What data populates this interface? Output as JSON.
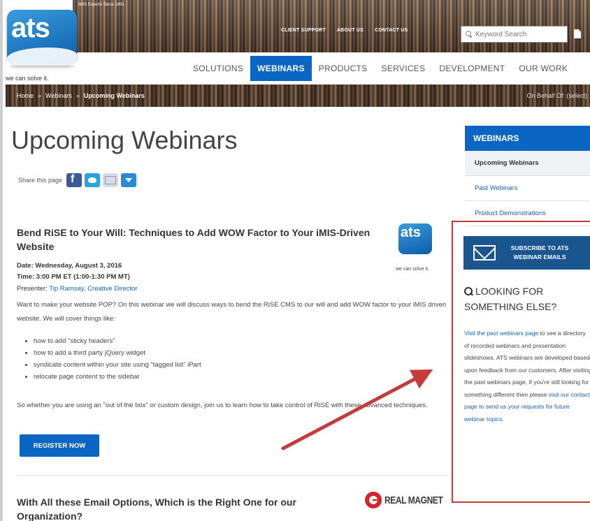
{
  "header": {
    "tagline_top": "iMIS Experts Since 1991",
    "logo_text": "ats",
    "logo_caption": "we can solve it.",
    "top_links": [
      "CLIENT SUPPORT",
      "ABOUT US",
      "CONTACT US"
    ],
    "search_placeholder": "Keyword Search"
  },
  "nav": {
    "items": [
      {
        "label": "SOLUTIONS",
        "active": false
      },
      {
        "label": "WEBINARS",
        "active": true
      },
      {
        "label": "PRODUCTS",
        "active": false
      },
      {
        "label": "SERVICES",
        "active": false
      },
      {
        "label": "DEVELOPMENT",
        "active": false
      },
      {
        "label": "OUR WORK",
        "active": false
      }
    ]
  },
  "breadcrumb": {
    "home": "Home",
    "section": "Webinars",
    "current": "Upcoming Webinars",
    "sep": "»",
    "behalf": "On Behalf Of: (select)"
  },
  "main": {
    "page_title": "Upcoming Webinars",
    "share_label": "Share this page",
    "webinar1": {
      "title": "Bend RiSE to Your Will: Techniques to Add WOW Factor to Your iMIS-Driven Website",
      "logo_text": "ats",
      "logo_caption": "we can solve it.",
      "date": "Date: Wednesday, August 3, 2016",
      "time": "Time: 3:00 PM ET (1:00-1:30 PM MT)",
      "presenter_label": "Presenter: ",
      "presenter_name": "Tip Ramsay, Creative Director",
      "description": "Want to make your website POP? On this webinar we will discuss ways to bend the RiSE CMS to our will and add WOW factor to your iMIS driven website. We will cover things like:",
      "bullets": [
        "how to add \"sticky headers\"",
        "how to add a third party jQuery widget",
        "syndicate content within your site using \"tagged list\" iPart",
        "relocate page content to the sidebar"
      ],
      "closing": "So whether you are using an \"out of the box\" or custom design, join us to learn how to take control of RiSE with these advanced techniques.",
      "register_label": "REGISTER NOW"
    },
    "webinar2": {
      "title": "With All these Email Options, Which is the Right One for our Organization?",
      "logo_text": "REAL MAGNET"
    }
  },
  "sidebar": {
    "heading": "WEBINARS",
    "items": [
      {
        "label": "Upcoming Webinars",
        "active": true
      },
      {
        "label": "Past Webinars",
        "active": false
      },
      {
        "label": "Product Demonstrations",
        "active": false
      }
    ],
    "subscribe_label": "SUBSCRIBE TO ATS WEBINAR EMAILS",
    "looking_heading": "LOOKING FOR SOMETHING ELSE?",
    "looking_link1": "Visit the past webinars page",
    "looking_text1": " to see a directory of recorded webinars and presentation slideshows. ATS webinars are developed based upon feedback from our customers. After visiting the past webinars page, if you're still looking for something different then please ",
    "looking_link2": "visit our contact page to send us your requests for future webinar topics."
  },
  "colors": {
    "brand_blue": "#0b65c2",
    "annotation_red": "#c73a3a"
  }
}
